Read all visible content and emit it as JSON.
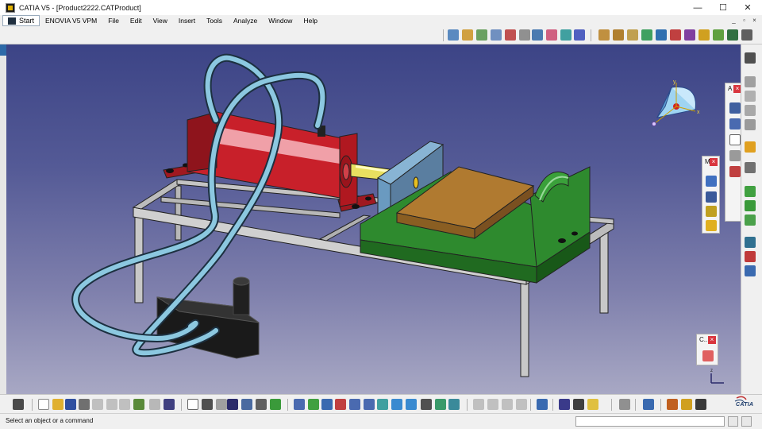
{
  "window": {
    "title": "CATIA V5 - [Product2222.CATProduct]",
    "minimize_glyph": "—",
    "maximize_glyph": "☐",
    "close_glyph": "✕"
  },
  "menubar": {
    "items": [
      "Start",
      "ENOVIA V5 VPM",
      "File",
      "Edit",
      "View",
      "Insert",
      "Tools",
      "Analyze",
      "Window",
      "Help"
    ],
    "doc_minimize_glyph": "_",
    "doc_restore_glyph": "▫",
    "doc_close_glyph": "×"
  },
  "palettes": {
    "annotation": {
      "title": "A"
    },
    "measure": {
      "title": "M"
    },
    "catalog": {
      "title": "C..."
    }
  },
  "status": {
    "message": "Select an object or a command",
    "command_value": ""
  },
  "compass": {
    "x_label": "x",
    "y_label": "y",
    "z_label": "z"
  },
  "logo": {
    "text": "CATIA"
  },
  "colors": {
    "background_top": "#3c4486",
    "background_bottom": "#a8a8c4",
    "cylinder_red": "#c8202a",
    "vise_green": "#2e8a2e",
    "workpiece_brown": "#b07a30",
    "piston_yellow": "#e8e060",
    "hose_blue": "#8cc8e0",
    "frame_grey": "#c8c8c8",
    "jaw_blue": "#6a9ac0"
  },
  "icons": [
    "manipulate-icon",
    "snap-icon",
    "explode-icon",
    "clash-icon",
    "sectioning-icon",
    "measure-icon",
    "fit-all-icon",
    "pan-icon",
    "rotate-icon",
    "zoom-in-icon",
    "zoom-out-icon",
    "normal-view-icon",
    "views-icon",
    "render-style-icon",
    "hide-show-icon",
    "swap-space-icon",
    "catalog-icon",
    "formula-icon",
    "knowledge-icon"
  ]
}
